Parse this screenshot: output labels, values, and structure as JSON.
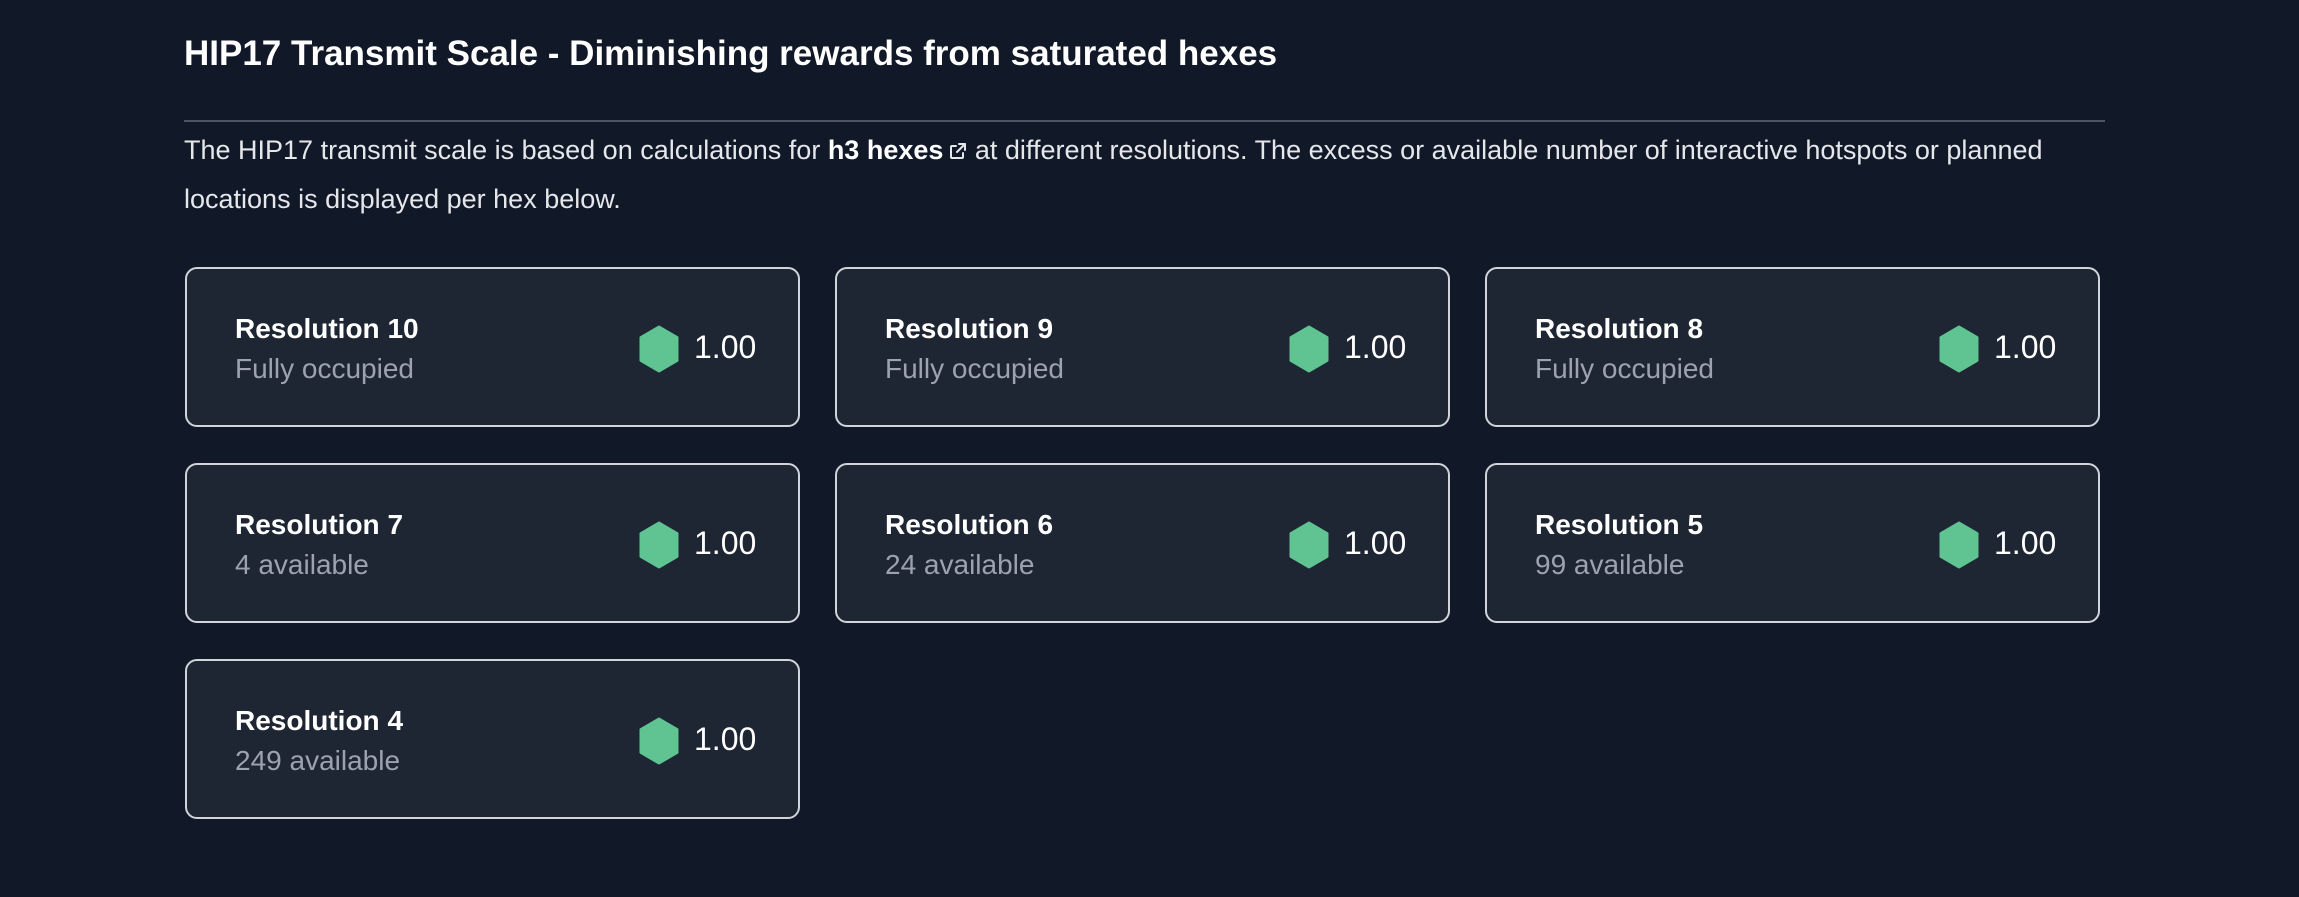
{
  "header": {
    "title": "HIP17 Transmit Scale - Diminishing rewards from saturated hexes"
  },
  "description": {
    "before": "The HIP17 transmit scale is based on calculations for ",
    "link_label": "h3 hexes",
    "link_icon": "external-link-icon",
    "after": " at different resolutions. The excess or available number of interactive hotspots or planned locations is displayed per hex below."
  },
  "colors": {
    "background": "#111827",
    "card_background": "#1f2633",
    "card_border": "#d1d5db",
    "hex_green": "#5fc492"
  },
  "cards": [
    {
      "name": "Resolution 10",
      "status": "Fully occupied",
      "icon": "hexagon-icon",
      "value": "1.00"
    },
    {
      "name": "Resolution 9",
      "status": "Fully occupied",
      "icon": "hexagon-icon",
      "value": "1.00"
    },
    {
      "name": "Resolution 8",
      "status": "Fully occupied",
      "icon": "hexagon-icon",
      "value": "1.00"
    },
    {
      "name": "Resolution 7",
      "status": "4 available",
      "icon": "hexagon-icon",
      "value": "1.00"
    },
    {
      "name": "Resolution 6",
      "status": "24 available",
      "icon": "hexagon-icon",
      "value": "1.00"
    },
    {
      "name": "Resolution 5",
      "status": "99 available",
      "icon": "hexagon-icon",
      "value": "1.00"
    },
    {
      "name": "Resolution 4",
      "status": "249 available",
      "icon": "hexagon-icon",
      "value": "1.00"
    }
  ]
}
